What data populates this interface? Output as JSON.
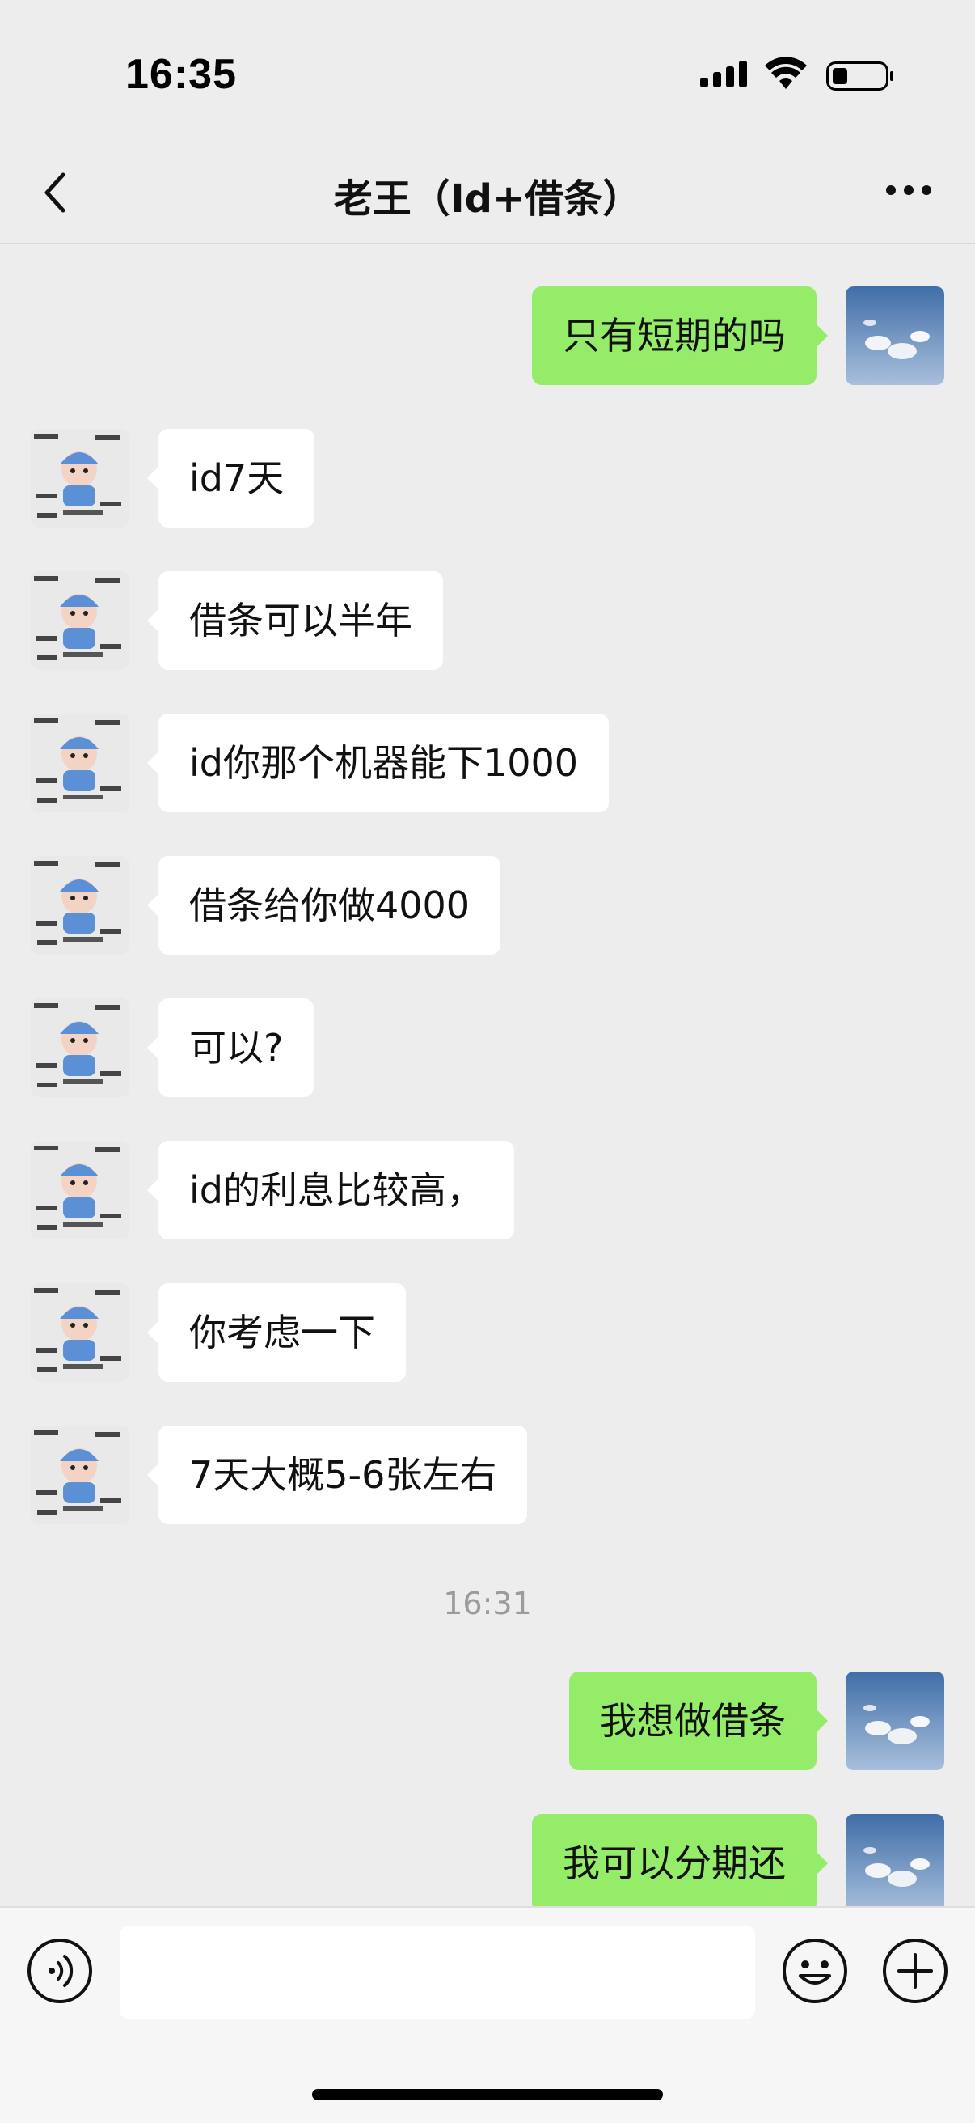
{
  "status_bar": {
    "time": "16:35",
    "icons": [
      "cellular-signal-icon",
      "wifi-icon",
      "battery-low-icon"
    ]
  },
  "nav": {
    "title": "老王（Id+借条）",
    "back_icon": "chevron-left-icon",
    "more_icon": "ellipsis-icon"
  },
  "messages": [
    {
      "side": "right",
      "text": "只有短期的吗"
    },
    {
      "side": "left",
      "text": "id7天"
    },
    {
      "side": "left",
      "text": "借条可以半年"
    },
    {
      "side": "left",
      "text": "id你那个机器能下1000"
    },
    {
      "side": "left",
      "text": "借条给你做4000"
    },
    {
      "side": "left",
      "text": "可以?"
    },
    {
      "side": "left",
      "text": "id的利息比较高，"
    },
    {
      "side": "left",
      "text": "你考虑一下"
    },
    {
      "side": "left",
      "text": "7天大概5-6张左右"
    },
    {
      "type": "timestamp",
      "text": "16:31"
    },
    {
      "side": "right",
      "text": "我想做借条"
    },
    {
      "side": "right",
      "text": "我可以分期还"
    }
  ],
  "input_bar": {
    "placeholder": "",
    "value": "",
    "icons": [
      "voice-icon",
      "emoji-icon",
      "plus-icon"
    ]
  },
  "colors": {
    "background": "#ededed",
    "bubble_self": "#95ec69",
    "bubble_other": "#ffffff",
    "timestamp_text": "#9b9b9b"
  }
}
